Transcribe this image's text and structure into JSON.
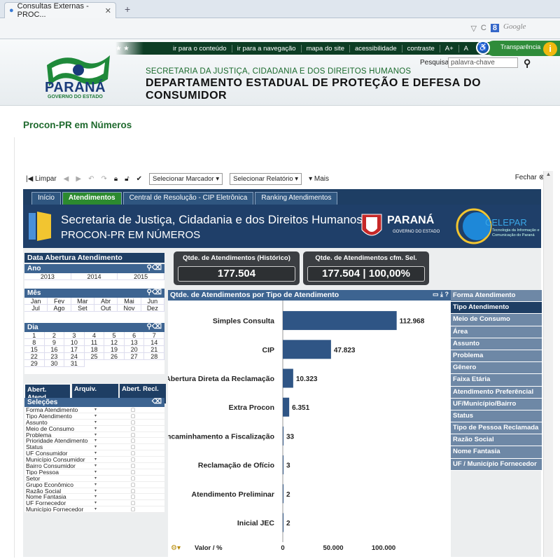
{
  "browser": {
    "tab_title": "Consultas Externas - PROC...",
    "google_placeholder": "Google"
  },
  "site": {
    "links": [
      "ir para o conteúdo",
      "ir para a navegação",
      "mapa do site",
      "acessibilidade",
      "contraste",
      "A+",
      "A"
    ],
    "transparencia": "Transparência",
    "search_label": "Pesquisar",
    "search_placeholder": "palavra-chave",
    "logo_name": "PARANÁ",
    "logo_sub": "GOVERNO DO ESTADO",
    "secretaria": "SECRETARIA DA JUSTIÇA, CIDADANIA E DOS DIREITOS HUMANOS",
    "departamento": "DEPARTAMENTO ESTADUAL DE PROTEÇÃO E DEFESA DO CONSUMIDOR"
  },
  "page_title": "Procon-PR em Números",
  "toolbar": {
    "limpar": "Limpar",
    "marcador": "Selecionar Marcador",
    "relatorio": "Selecionar Relatório",
    "mais": "Mais",
    "fechar": "Fechar"
  },
  "tabs": [
    "Início",
    "Atendimentos",
    "Central de Resolução - CIP Eletrônica",
    "Ranking Atendimentos"
  ],
  "banner": {
    "line1": "Secretaria de Justiça, Cidadania e dos Direitos Humanos",
    "line2": "PROCON-PR EM NÚMEROS",
    "parana": "PARANÁ",
    "gov": "GOVERNO DO ESTADO",
    "celepar": "CELEPAR",
    "celepar_sub": "Tecnologia da Informação e Comunicação do Paraná"
  },
  "data_abertura": {
    "title": "Data Abertura Atendimento",
    "ano_label": "Ano",
    "anos": [
      "2013",
      "2014",
      "2015"
    ],
    "mes_label": "Mês",
    "meses": [
      "Jan",
      "Fev",
      "Mar",
      "Abr",
      "Mai",
      "Jun",
      "Jul",
      "Ago",
      "Set",
      "Out",
      "Nov",
      "Dez"
    ],
    "dia_label": "Dia",
    "dias": [
      "1",
      "2",
      "3",
      "4",
      "5",
      "6",
      "7",
      "8",
      "9",
      "10",
      "11",
      "12",
      "13",
      "14",
      "15",
      "16",
      "17",
      "18",
      "19",
      "20",
      "21",
      "22",
      "23",
      "24",
      "25",
      "26",
      "27",
      "28",
      "29",
      "30",
      "31"
    ]
  },
  "bottom_tabs": [
    "Abert. Atend.",
    "Arquiv.",
    "Abert. Recl."
  ],
  "selecoes": {
    "title": "Seleções",
    "items": [
      "Forma Atendimento",
      "Tipo Atendimento",
      "Assunto",
      "Meio de Consumo",
      "Problema",
      "Prioridade Atendimento",
      "Status",
      "UF Consumidor",
      "Município Consumidor",
      "Bairro Consumidor",
      "Tipo Pessoa",
      "Setor",
      "Grupo Econômico",
      "Razão Social",
      "Nome Fantasia",
      "UF Fornecedor",
      "Município Fornecedor"
    ]
  },
  "kpis": [
    {
      "title": "Qtde. de Atendimentos (Histórico)",
      "value": "177.504"
    },
    {
      "title": "Qtde. de Atendimentos cfm. Sel.",
      "value": "177.504 | 100,00%"
    }
  ],
  "chart_data": {
    "type": "bar",
    "title": "Qtde. de Atendimentos por Tipo de Atendimento",
    "categories": [
      "Simples Consulta",
      "CIP",
      "Abertura Direta da Reclamação",
      "Extra Procon",
      "Encaminhamento a Fiscalização",
      "Reclamação de Ofício",
      "Atendimento Preliminar",
      "Inicial JEC"
    ],
    "values": [
      112968,
      47823,
      10323,
      6351,
      33,
      3,
      2,
      2
    ],
    "labels": [
      "112.968",
      "47.823",
      "10.323",
      "6.351",
      "33",
      "3",
      "2",
      "2"
    ],
    "xlabel": "Valor / %",
    "xticks": [
      "0",
      "50.000",
      "100.000"
    ],
    "xlim": [
      0,
      140000
    ],
    "color": "#2f5585"
  },
  "dimensions": [
    "Forma Atendimento",
    "Tipo Atendimento",
    "Meio de Consumo",
    "Área",
    "Assunto",
    "Problema",
    "Gênero",
    "Faixa Etária",
    "Atendimento Preferêncial",
    "UF/Município/Bairro",
    "Status",
    "Tipo de Pessoa Reclamada",
    "Razão Social",
    "Nome Fantasia",
    "UF / Município Fornecedor"
  ],
  "dimension_active": "Tipo Atendimento"
}
